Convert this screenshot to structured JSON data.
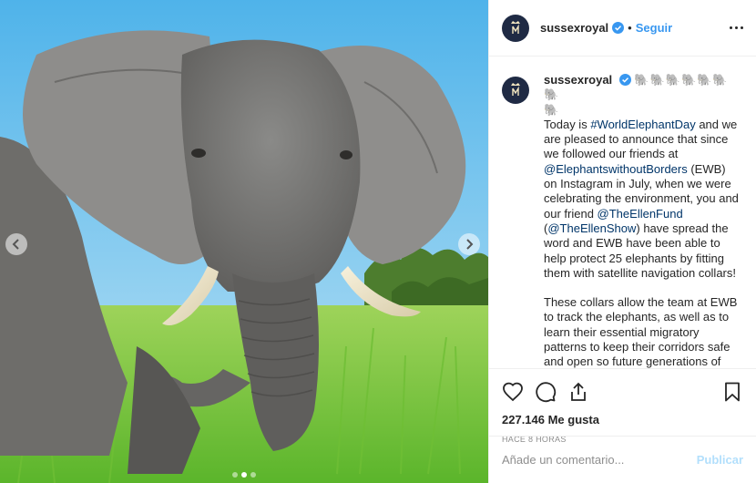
{
  "account": {
    "username": "sussexroyal",
    "follow_label": "Seguir",
    "bullet": "•"
  },
  "caption": {
    "elephants": "🐘🐘🐘🐘🐘🐘🐘",
    "elephants_line2": "🐘",
    "p1_a": "Today is ",
    "hashtag": "#WorldElephantDay",
    "p1_b": " and we are pleased to announce that since we followed our friends at ",
    "mention_ewb": "@ElephantswithoutBorders",
    "p1_c": " (EWB) on Instagram in July, when we were celebrating the environment, you and our friend ",
    "mention_ellenfund": "@TheEllenFund",
    "p1_d": " (",
    "mention_ellenshow": "@TheEllenShow",
    "p1_e": ") have spread the word and EWB have been able to help protect 25 elephants by fitting them with satellite navigation collars!",
    "p2": "These collars allow the team at EWB to track the elephants, as well as to learn their essential migratory patterns to keep their corridors safe and open so future generations of elephants can roam freely. In honour"
  },
  "stats": {
    "likes": "227.146 Me gusta",
    "time": "HACE 8 HORAS"
  },
  "comment": {
    "placeholder": "Añade un comentario...",
    "publish_label": "Publicar"
  },
  "colors": {
    "link": "#003569",
    "follow": "#3897f0",
    "verified": "#3897f0",
    "publish_disabled": "#b2dffc",
    "avatar_bg": "#1f2a44"
  },
  "icons": [
    "verified-icon",
    "more-options-icon",
    "like-heart-icon",
    "comment-icon",
    "share-icon",
    "save-bookmark-icon",
    "carousel-prev-icon",
    "carousel-next-icon"
  ],
  "carousel": {
    "slides": 3,
    "active_index": 1
  }
}
